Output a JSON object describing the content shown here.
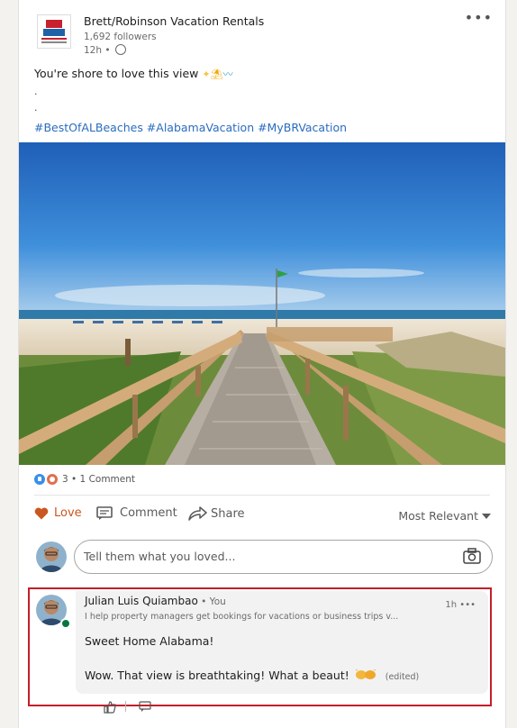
{
  "post": {
    "author": "Brett/Robinson Vacation Rentals",
    "followers": "1,692 followers",
    "time": "12h •",
    "text": "You're shore to love this view",
    "dot1": ".",
    "dot2": ".",
    "hashtags": "#BestOfALBeaches #AlabamaVacation #MyBRVacation",
    "more_icon": "•••"
  },
  "social": {
    "counts": "3 • 1 Comment"
  },
  "actions": {
    "love": "Love",
    "comment": "Comment",
    "share": "Share",
    "sort": "Most Relevant"
  },
  "compose": {
    "placeholder": "Tell them what you loved..."
  },
  "comment": {
    "name": "Julian Luis Quiambao",
    "you": " • You",
    "headline": "I help property managers get bookings for vacations or business trips v...",
    "time": "1h •••",
    "line1": "Sweet Home Alabama!",
    "line2": "Wow. That view is breathtaking! What a beaut!",
    "edited": "(edited)"
  },
  "colors": {
    "love": "#c9571f",
    "hashtag": "#2a6cbf",
    "highlight": "#c41e2a",
    "online": "#057642"
  }
}
